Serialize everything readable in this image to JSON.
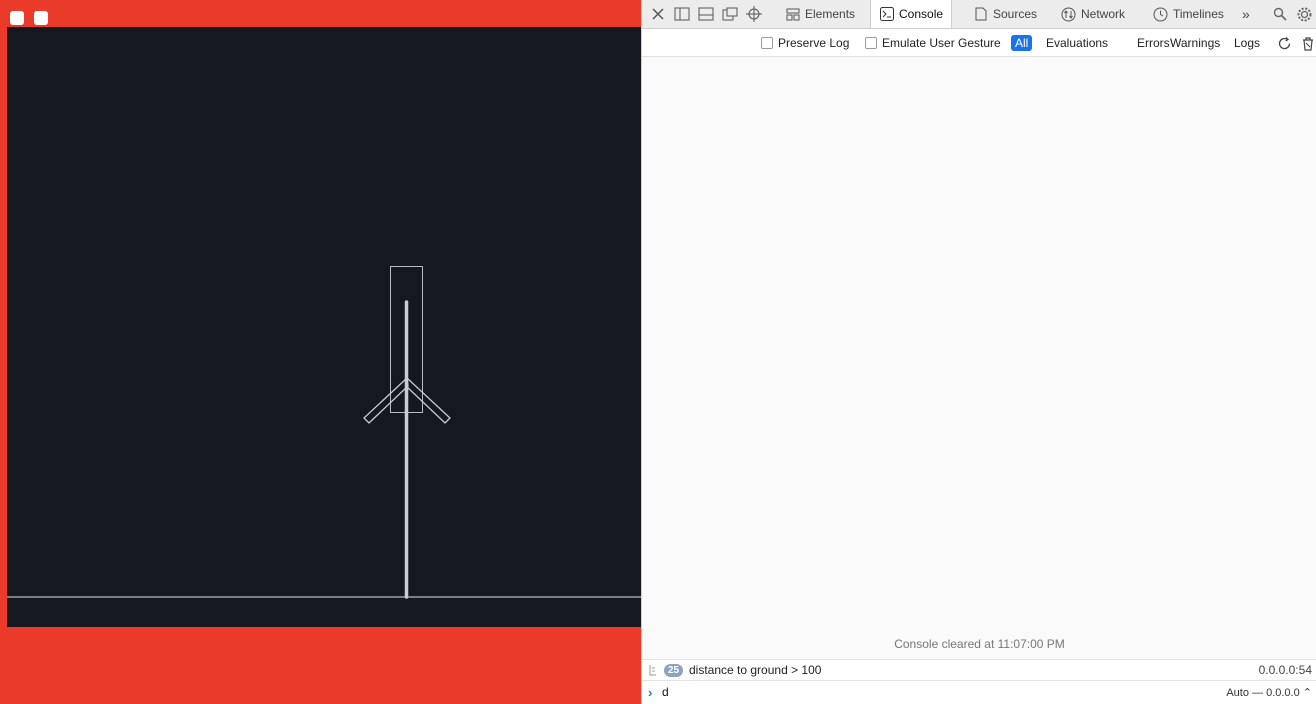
{
  "devtools": {
    "tabs": [
      {
        "label": "Elements",
        "icon": "elements-icon"
      },
      {
        "label": "Console",
        "icon": "console-icon"
      },
      {
        "label": "Sources",
        "icon": "sources-icon"
      },
      {
        "label": "Network",
        "icon": "network-icon"
      },
      {
        "label": "Timelines",
        "icon": "timelines-icon"
      }
    ],
    "more_label": "»",
    "filters": {
      "preserve_log": "Preserve Log",
      "emulate_gesture": "Emulate User Gesture",
      "all": "All",
      "evaluations": "Evaluations",
      "errors": "Errors",
      "warnings": "Warnings",
      "logs": "Logs"
    },
    "console": {
      "cleared": "Console cleared at 11:07:00 PM",
      "message": {
        "count": "25",
        "text": "distance to ground > 100",
        "source": "0.0.0.0:54"
      },
      "prompt_value": "d",
      "context": "Auto — 0.0.0.0 ⌃"
    }
  },
  "colors": {
    "frame": "#ea3a2a",
    "canvas": "#151821",
    "accent": "#1a73e8"
  }
}
